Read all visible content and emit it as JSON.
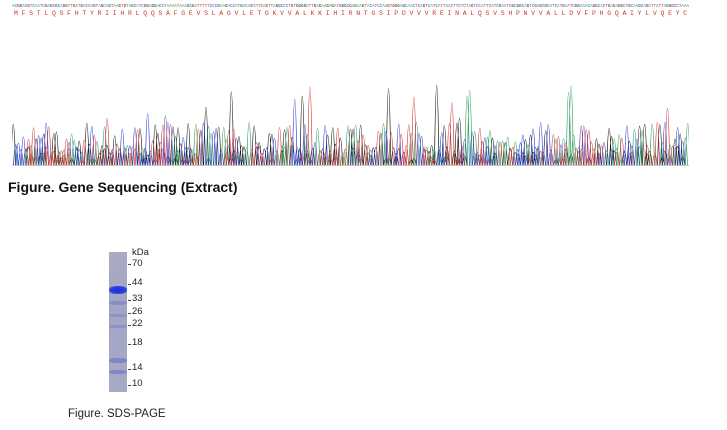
{
  "figures": {
    "sequencing": {
      "caption": "Figure. Gene Sequencing (Extract)",
      "amino_acids": "MFSTLQSFHTYRIIHRLQQSAFGEVSLAGVLETGKVVALKKIHIRNTGSIPDVVVREINALQSVSHPNVVALLDVFPHGQAIYLVQEYC",
      "base_colors": {
        "A": "#2a9a5a",
        "C": "#2b3fcf",
        "G": "#111111",
        "T": "#d03434"
      },
      "trace_colors": [
        "#111111",
        "#2a9a5a",
        "#2b3fcf",
        "#d03434"
      ]
    },
    "sds_page": {
      "caption": "Figure. SDS-PAGE",
      "unit_label": "kDa",
      "markers": [
        "70",
        "44",
        "33",
        "26",
        "22",
        "18",
        "14",
        "10"
      ]
    }
  }
}
